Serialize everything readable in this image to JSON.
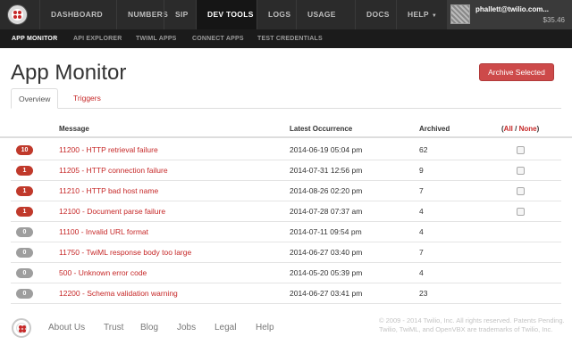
{
  "topnav": {
    "items": [
      "DASHBOARD",
      "NUMBERS",
      "SIP",
      "DEV TOOLS",
      "LOGS",
      "USAGE",
      "DOCS",
      "HELP"
    ],
    "active": "DEV TOOLS",
    "account_email": "phallett@twilio.com...",
    "account_balance": "$35.46"
  },
  "subnav": {
    "items": [
      "APP MONITOR",
      "API EXPLORER",
      "TWIML APPS",
      "CONNECT APPS",
      "TEST CREDENTIALS"
    ],
    "active": "APP MONITOR"
  },
  "page": {
    "title": "App Monitor",
    "archive_button": "Archive Selected"
  },
  "tabs": [
    "Overview",
    "Triggers"
  ],
  "table": {
    "headers": {
      "message": "Message",
      "latest": "Latest Occurrence",
      "archived": "Archived",
      "open_paren": "(",
      "all": "All",
      "slash": " / ",
      "none": "None",
      "close_paren": ")"
    },
    "rows": [
      {
        "count": "10",
        "badge": "red",
        "message": "11200 - HTTP retrieval failure",
        "latest": "2014-06-19 05:04 pm",
        "archived": "62",
        "checkbox": true
      },
      {
        "count": "1",
        "badge": "red",
        "message": "11205 - HTTP connection failure",
        "latest": "2014-07-31 12:56 pm",
        "archived": "9",
        "checkbox": true
      },
      {
        "count": "1",
        "badge": "red",
        "message": "11210 - HTTP bad host name",
        "latest": "2014-08-26 02:20 pm",
        "archived": "7",
        "checkbox": true
      },
      {
        "count": "1",
        "badge": "red",
        "message": "12100 - Document parse failure",
        "latest": "2014-07-28 07:37 am",
        "archived": "4",
        "checkbox": true
      },
      {
        "count": "0",
        "badge": "grey",
        "message": "11100 - Invalid URL format",
        "latest": "2014-07-11 09:54 pm",
        "archived": "4",
        "checkbox": false
      },
      {
        "count": "0",
        "badge": "grey",
        "message": "11750 - TwiML response body too large",
        "latest": "2014-06-27 03:40 pm",
        "archived": "7",
        "checkbox": false
      },
      {
        "count": "0",
        "badge": "grey",
        "message": "500 - Unknown error code",
        "latest": "2014-05-20 05:39 pm",
        "archived": "4",
        "checkbox": false
      },
      {
        "count": "0",
        "badge": "grey",
        "message": "12200 - Schema validation warning",
        "latest": "2014-06-27 03:41 pm",
        "archived": "23",
        "checkbox": false
      }
    ]
  },
  "footer": {
    "links": [
      "About Us",
      "Trust",
      "Blog",
      "Jobs",
      "Legal",
      "Help"
    ],
    "copyright": "© 2009 - 2014 Twilio, Inc. All rights reserved. Patents Pending. Twilio, TwiML, and OpenVBX are trademarks of Twilio, Inc."
  },
  "colors": {
    "accent": "#c62828",
    "nav_bg": "#2b2b2b",
    "subnav_bg": "#1b1b1b",
    "button_bg": "#cd4a4a"
  },
  "icons": [
    "twilio-logo-icon",
    "chevron-down-icon",
    "avatar-image"
  ]
}
